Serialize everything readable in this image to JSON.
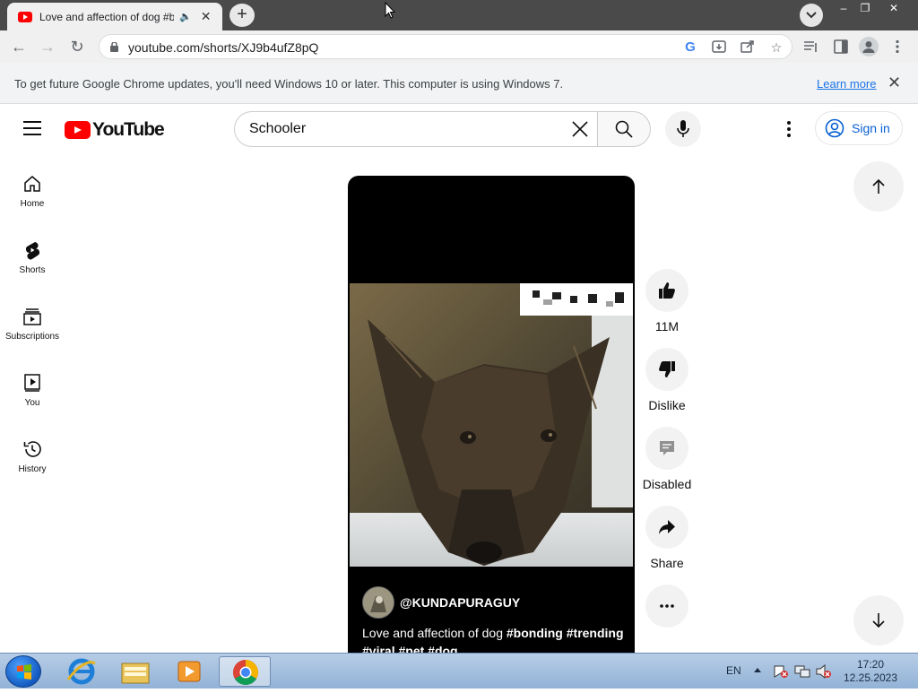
{
  "browser": {
    "tab": {
      "title": "Love and affection of dog #bonding #trending #viral #pet #dog",
      "audio_icon": "speaker-icon",
      "close_glyph": "✕"
    },
    "new_tab_glyph": "+",
    "tab_search_glyph": "⌄",
    "window_controls": {
      "minimize": "–",
      "restore": "❐",
      "close": "✕"
    },
    "nav": {
      "back": "←",
      "forward": "→",
      "reload": "↻"
    },
    "url": "youtube.com/shorts/XJ9b4ufZ8pQ",
    "omnibox_icons": [
      "google-lens-icon",
      "install-icon",
      "share-icon",
      "bookmark-star-icon"
    ],
    "toolbar_icons": [
      "reading-list-icon",
      "side-panel-icon",
      "profile-icon",
      "chrome-menu-icon"
    ],
    "infobar": {
      "message": "To get future Google Chrome updates, you'll need Windows 10 or later. This computer is using Windows 7.",
      "link": "Learn more",
      "close_glyph": "✕"
    }
  },
  "youtube": {
    "logo_text": "YouTube",
    "search": {
      "value": "Schooler",
      "placeholder": "Search"
    },
    "sign_in_label": "Sign in",
    "guide": [
      {
        "label": "Home",
        "icon": "home-icon"
      },
      {
        "label": "Shorts",
        "icon": "shorts-icon"
      },
      {
        "label": "Subscriptions",
        "icon": "subscriptions-icon"
      },
      {
        "label": "You",
        "icon": "you-icon"
      },
      {
        "label": "History",
        "icon": "history-icon"
      }
    ],
    "short": {
      "channel": "@KUNDAPURAGUY",
      "caption_text": "Love and affection of dog",
      "hashtags_line1": "#bonding #trending",
      "hashtags_line2": "#viral #pet #dog",
      "actions": [
        {
          "label": "11M",
          "icon": "thumbs-up-icon"
        },
        {
          "label": "Dislike",
          "icon": "thumbs-down-icon"
        },
        {
          "label": "Disabled",
          "icon": "comments-icon"
        },
        {
          "label": "Share",
          "icon": "share-icon"
        },
        {
          "label": "",
          "icon": "more-icon"
        }
      ]
    }
  },
  "taskbar": {
    "apps": [
      "internet-explorer-icon",
      "file-explorer-icon",
      "media-player-icon",
      "chrome-icon"
    ],
    "language": "EN",
    "time": "17:20",
    "date": "12.25.2023"
  },
  "colors": {
    "brand_red": "#ff0000",
    "link_blue": "#065fd4",
    "chrome_dark": "#4a4a4a"
  }
}
